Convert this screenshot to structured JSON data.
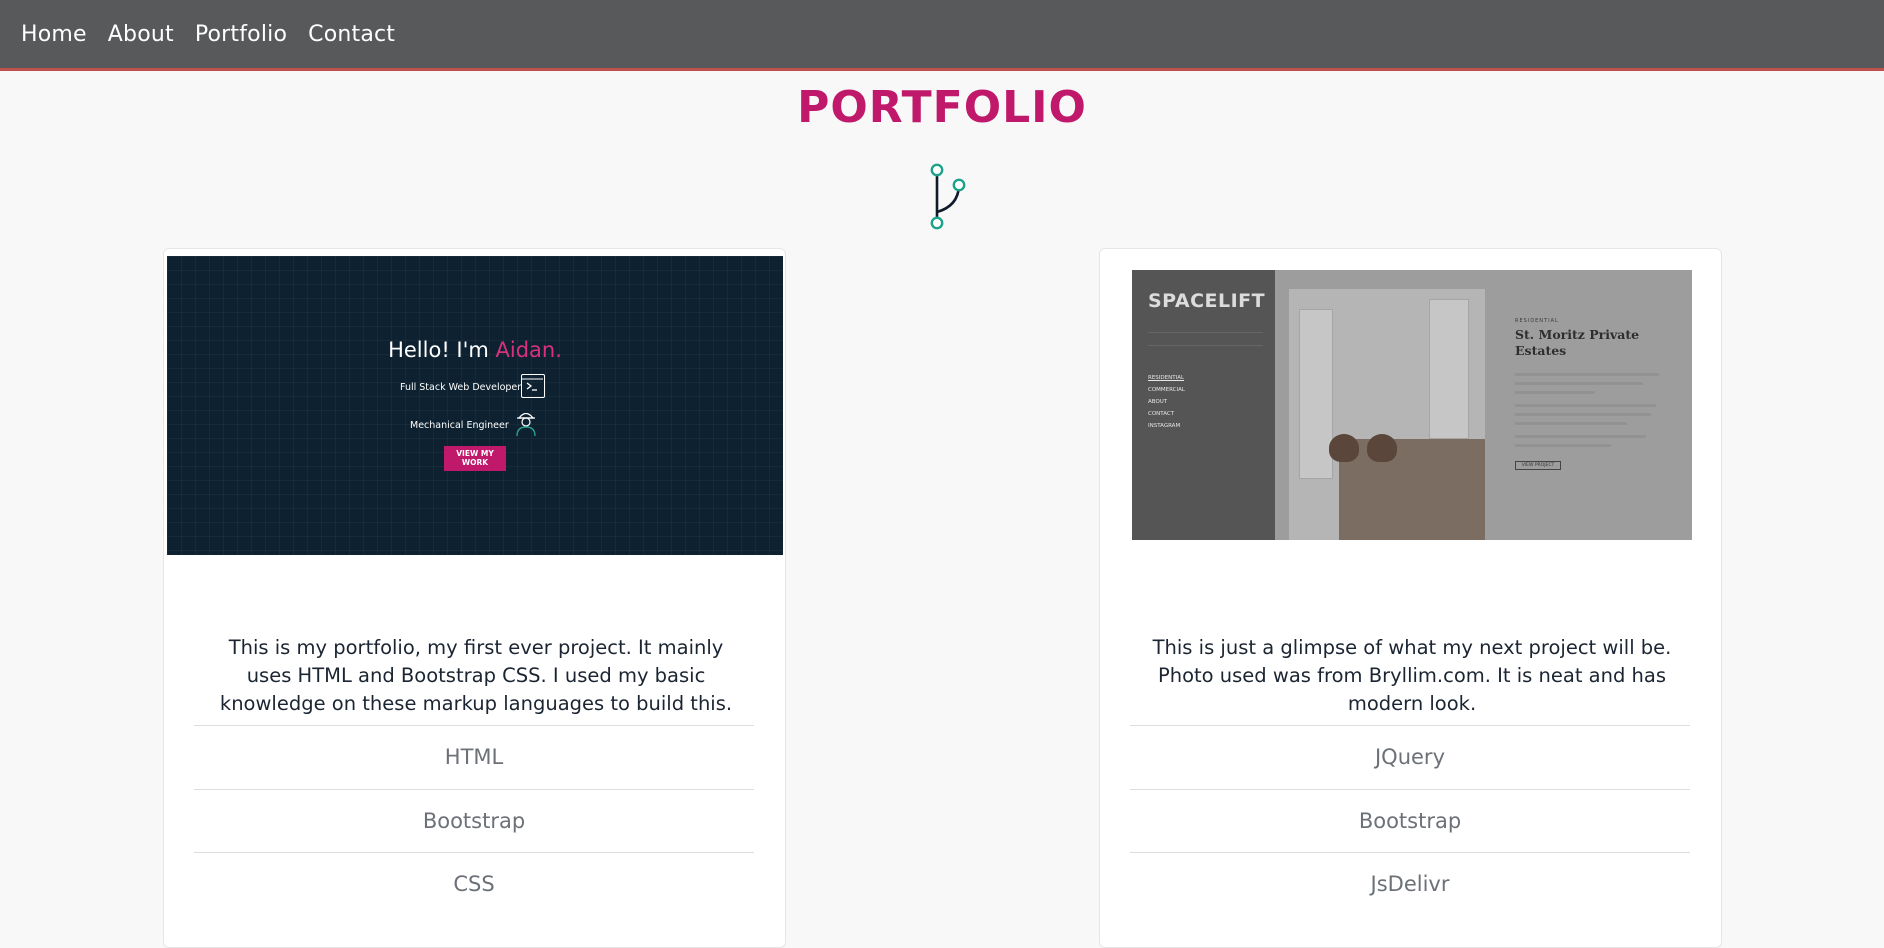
{
  "nav": {
    "items": [
      "Home",
      "About",
      "Portfolio",
      "Contact"
    ]
  },
  "page": {
    "title": "PORTFOLIO",
    "accent_color": "#c0186a",
    "icon": "git-branch-icon"
  },
  "projects": [
    {
      "screenshot": {
        "greeting": "Hello! I'm ",
        "name": "Aidan.",
        "roles": [
          "Full Stack Web Developer",
          "Mechanical Engineer"
        ],
        "role_icons": [
          "terminal-icon",
          "engineer-icon"
        ],
        "cta_label": "VIEW MY WORK"
      },
      "description": "This is my portfolio, my first ever project. It mainly uses HTML and Bootstrap CSS. I used my basic knowledge on these markup languages to build this.",
      "tech": [
        "HTML",
        "Bootstrap",
        "CSS"
      ]
    },
    {
      "screenshot": {
        "logo": "SPACELIFT",
        "menu": [
          "RESIDENTIAL",
          "COMMERCIAL",
          "ABOUT",
          "CONTACT",
          "INSTAGRAM"
        ],
        "kicker": "RESIDENTIAL",
        "title": "St. Moritz Private Estates",
        "button": "VIEW PROJECT"
      },
      "description": "This is just a glimpse of what my next project will be. Photo used was from Bryllim.com. It is neat and has modern look.",
      "tech": [
        "JQuery",
        "Bootstrap",
        "JsDelivr"
      ]
    }
  ]
}
